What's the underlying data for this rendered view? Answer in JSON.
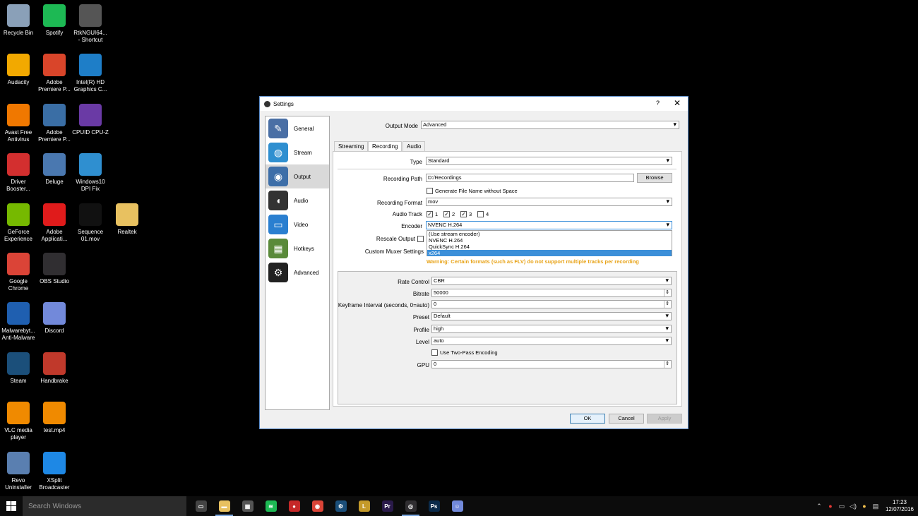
{
  "desktop": {
    "icons": [
      {
        "label": "Recycle Bin",
        "icon": "recycle-bin-icon",
        "color": "#8aa0b8"
      },
      {
        "label": "Spotify",
        "icon": "spotify-icon",
        "color": "#1db954"
      },
      {
        "label": "RtkNGUI64... - Shortcut",
        "icon": "realtek-speaker-icon",
        "color": "#555555"
      },
      {
        "label": "Audacity",
        "icon": "audacity-icon",
        "color": "#f2a900"
      },
      {
        "label": "Adobe Premiere P...",
        "icon": "adobe-file-icon",
        "color": "#d9452a"
      },
      {
        "label": "Intel(R) HD Graphics C...",
        "icon": "intel-graphics-icon",
        "color": "#1e7ec8"
      },
      {
        "label": "Avast Free Antivirus",
        "icon": "avast-icon",
        "color": "#f07800"
      },
      {
        "label": "Adobe Premiere P...",
        "icon": "premiere-window-icon",
        "color": "#3a6ea5"
      },
      {
        "label": "CPUID CPU-Z",
        "icon": "cpuz-icon",
        "color": "#6a3aa5"
      },
      {
        "label": "Driver Booster...",
        "icon": "driver-booster-icon",
        "color": "#d32f2f"
      },
      {
        "label": "Deluge",
        "icon": "deluge-icon",
        "color": "#4a78b0"
      },
      {
        "label": "Windows10 DPI Fix",
        "icon": "monitor-icon",
        "color": "#2f8fd0"
      },
      {
        "label": "GeForce Experience",
        "icon": "geforce-icon",
        "color": "#76b900"
      },
      {
        "label": "Adobe Applicati...",
        "icon": "adobe-app-icon",
        "color": "#e01b1b"
      },
      {
        "label": "Sequence 01.mov",
        "icon": "video-file-icon",
        "color": "#111111"
      },
      {
        "label": "Realtek",
        "icon": "folder-icon",
        "color": "#e8c160"
      },
      {
        "label": "Google Chrome",
        "icon": "chrome-icon",
        "color": "#db4437"
      },
      {
        "label": "OBS Studio",
        "icon": "obs-icon",
        "color": "#302e31"
      },
      {
        "label": "Malwarebyt... Anti-Malware",
        "icon": "malwarebytes-icon",
        "color": "#1f5fb0"
      },
      {
        "label": "Discord",
        "icon": "discord-icon",
        "color": "#7289da"
      },
      {
        "label": "Steam",
        "icon": "steam-icon",
        "color": "#1b4f7a"
      },
      {
        "label": "Handbrake",
        "icon": "handbrake-icon",
        "color": "#c0392b"
      },
      {
        "label": "VLC media player",
        "icon": "vlc-icon",
        "color": "#f08a00"
      },
      {
        "label": "test.mp4",
        "icon": "vlc-file-icon",
        "color": "#f08a00"
      },
      {
        "label": "Revo Uninstaller",
        "icon": "revo-icon",
        "color": "#5a7fb0"
      },
      {
        "label": "XSplit Broadcaster",
        "icon": "xsplit-icon",
        "color": "#1e88e5"
      }
    ]
  },
  "taskbar": {
    "search_placeholder": "Search Windows",
    "apps": [
      {
        "name": "task-view-icon",
        "glyph": "▭",
        "color": "#444444"
      },
      {
        "name": "file-explorer-icon",
        "glyph": "▬",
        "color": "#e8c160"
      },
      {
        "name": "store-icon",
        "glyph": "▦",
        "color": "#555555"
      },
      {
        "name": "spotify-icon",
        "glyph": "≋",
        "color": "#1db954"
      },
      {
        "name": "app-red-icon",
        "glyph": "●",
        "color": "#c62828"
      },
      {
        "name": "chrome-icon",
        "glyph": "◉",
        "color": "#db4437"
      },
      {
        "name": "steam-icon",
        "glyph": "⚙",
        "color": "#1b4f7a"
      },
      {
        "name": "app-l-icon",
        "glyph": "L",
        "color": "#c49a2a"
      },
      {
        "name": "premiere-icon",
        "glyph": "Pr",
        "color": "#2a1a4a"
      },
      {
        "name": "obs-icon",
        "glyph": "◎",
        "color": "#302e31"
      },
      {
        "name": "photoshop-icon",
        "glyph": "Ps",
        "color": "#0a2a4a"
      },
      {
        "name": "discord-icon",
        "glyph": "☺",
        "color": "#7289da"
      }
    ],
    "clock_time": "17:23",
    "clock_date": "12/07/2016"
  },
  "settings": {
    "title": "Settings",
    "help": "?",
    "close": "✕",
    "sidebar": [
      {
        "label": "General",
        "icon": "general-icon",
        "color": "#4a6fa5"
      },
      {
        "label": "Stream",
        "icon": "stream-globe-icon",
        "color": "#2f8fd0"
      },
      {
        "label": "Output",
        "icon": "output-antenna-icon",
        "color": "#3d6ea8"
      },
      {
        "label": "Audio",
        "icon": "audio-speaker-icon",
        "color": "#333333"
      },
      {
        "label": "Video",
        "icon": "video-monitor-icon",
        "color": "#2a7fd0"
      },
      {
        "label": "Hotkeys",
        "icon": "hotkeys-keyboard-icon",
        "color": "#5a8a3a"
      },
      {
        "label": "Advanced",
        "icon": "advanced-gears-icon",
        "color": "#222222"
      }
    ],
    "output_mode_label": "Output Mode",
    "output_mode_value": "Advanced",
    "tabs": [
      "Streaming",
      "Recording",
      "Audio"
    ],
    "type_label": "Type",
    "type_value": "Standard",
    "recording_path_label": "Recording Path",
    "recording_path_value": "D:/Recordings",
    "browse_label": "Browse",
    "gen_filename_label": "Generate File Name without Space",
    "recording_format_label": "Recording Format",
    "recording_format_value": "mov",
    "audio_track_label": "Audio Track",
    "audio_tracks": [
      {
        "label": "1",
        "checked": true
      },
      {
        "label": "2",
        "checked": true
      },
      {
        "label": "3",
        "checked": true
      },
      {
        "label": "4",
        "checked": false
      }
    ],
    "encoder_label": "Encoder",
    "encoder_value": "NVENC H.264",
    "encoder_options": [
      "(Use stream encoder)",
      "NVENC H.264",
      "QuickSync H.264",
      "x264"
    ],
    "rescale_label": "Rescale Output",
    "muxer_label": "Custom Muxer Settings",
    "warning": "Warning: Certain formats (such as FLV) do not support multiple tracks per recording",
    "rate_control_label": "Rate Control",
    "rate_control_value": "CBR",
    "bitrate_label": "Bitrate",
    "bitrate_value": "50000",
    "keyframe_label": "Keyframe Interval (seconds, 0=auto)",
    "keyframe_value": "0",
    "preset_label": "Preset",
    "preset_value": "Default",
    "profile_label": "Profile",
    "profile_value": "high",
    "level_label": "Level",
    "level_value": "auto",
    "two_pass_label": "Use Two-Pass Encoding",
    "gpu_label": "GPU",
    "gpu_value": "0",
    "ok_label": "OK",
    "cancel_label": "Cancel",
    "apply_label": "Apply"
  }
}
